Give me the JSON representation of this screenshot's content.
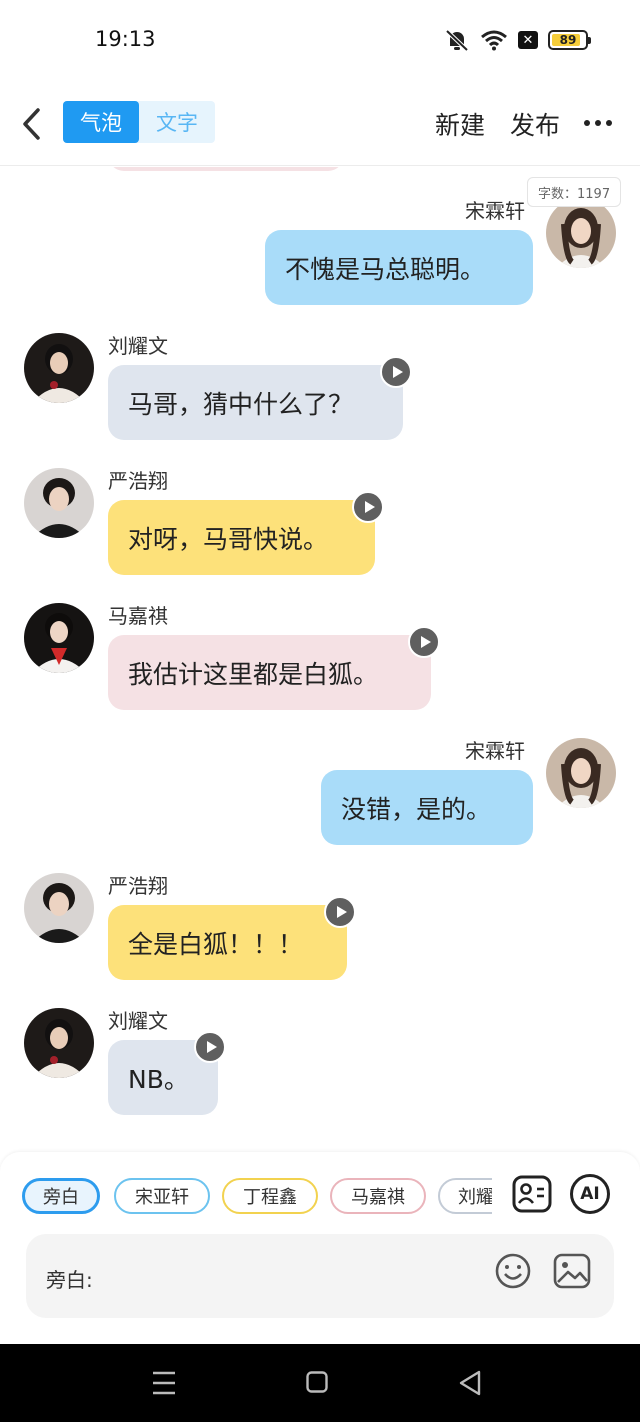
{
  "status_bar": {
    "time": "19:13",
    "battery": "89",
    "battery_percent": 89
  },
  "nav": {
    "segments": [
      {
        "label": "气泡",
        "active": true
      },
      {
        "label": "文字",
        "active": false
      }
    ],
    "new_label": "新建",
    "publish_label": "发布"
  },
  "word_count": "字数：1197",
  "messages": [
    {
      "side": "right",
      "name": "宋霖轩",
      "text": "不愧是马总聪明。",
      "bubble_color": "#a9dcf9",
      "avatar": "girl",
      "has_play": false
    },
    {
      "side": "left",
      "name": "刘耀文",
      "text": "马哥，猜中什么了？",
      "bubble_color": "#dfe5ee",
      "avatar": "boy-white",
      "has_play": true
    },
    {
      "side": "left",
      "name": "严浩翔",
      "text": "对呀，马哥快说。",
      "bubble_color": "#fde17a",
      "avatar": "boy-dark",
      "has_play": true
    },
    {
      "side": "left",
      "name": "马嘉祺",
      "text": "我估计这里都是白狐。",
      "bubble_color": "#f5e1e4",
      "avatar": "boy-red",
      "has_play": true
    },
    {
      "side": "right",
      "name": "宋霖轩",
      "text": "没错，是的。",
      "bubble_color": "#a9dcf9",
      "avatar": "girl",
      "has_play": false
    },
    {
      "side": "left",
      "name": "严浩翔",
      "text": "全是白狐！！！",
      "bubble_color": "#fde17a",
      "avatar": "boy-dark",
      "has_play": true
    },
    {
      "side": "left",
      "name": "刘耀文",
      "text": "NB。",
      "bubble_color": "#dfe5ee",
      "avatar": "boy-white",
      "has_play": true
    }
  ],
  "characters": [
    {
      "label": "旁白",
      "color": "#2d9cee",
      "selected": true
    },
    {
      "label": "宋亚轩",
      "color": "#6cc3ef",
      "selected": false
    },
    {
      "label": "丁程鑫",
      "color": "#f2d24f",
      "selected": false
    },
    {
      "label": "马嘉祺",
      "color": "#eab4bb",
      "selected": false
    },
    {
      "label": "刘耀文",
      "color": "#c3cbd6",
      "selected": false
    }
  ],
  "tools": {
    "ai_label": "AI",
    "contact_icon": "contact-card-icon"
  },
  "input": {
    "label": "旁白:"
  },
  "icons": [
    "back-chevron-icon",
    "mute-bell-icon",
    "wifi-icon",
    "close-box-icon",
    "battery-icon",
    "more-dots-icon",
    "play-icon",
    "emoji-icon",
    "image-icon",
    "menu-icon",
    "home-square-icon",
    "back-triangle-icon"
  ]
}
